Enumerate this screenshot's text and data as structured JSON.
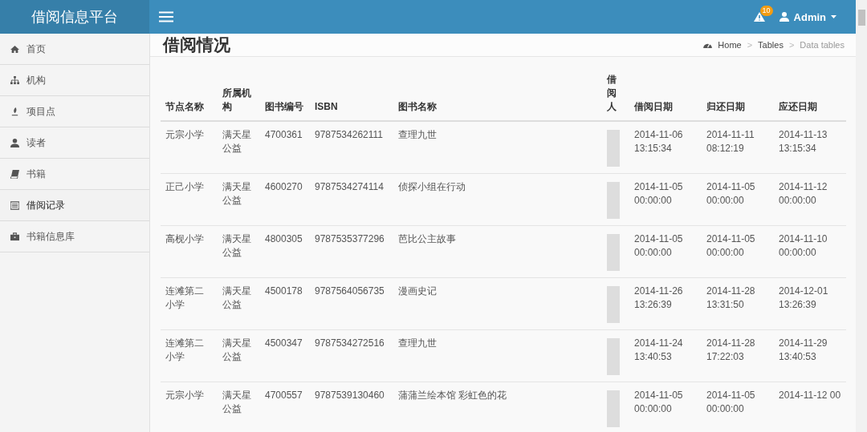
{
  "app": {
    "title": "借阅信息平台"
  },
  "navbar": {
    "alerts_badge": "10",
    "user": "Admin"
  },
  "sidebar": {
    "items": [
      {
        "label": "首页",
        "kind": "home",
        "selected": false
      },
      {
        "label": "机构",
        "kind": "sitemap",
        "selected": false
      },
      {
        "label": "项目点",
        "kind": "pin",
        "selected": false
      },
      {
        "label": "读者",
        "kind": "user",
        "selected": false
      },
      {
        "label": "书籍",
        "kind": "book",
        "selected": false
      },
      {
        "label": "借阅记录",
        "kind": "list",
        "selected": true
      },
      {
        "label": "书籍信息库",
        "kind": "briefcase",
        "selected": false
      }
    ]
  },
  "page": {
    "title": "借阅情况",
    "breadcrumb": [
      {
        "kind": "home",
        "label": "Home"
      },
      {
        "kind": "separator",
        "label": ">"
      },
      {
        "kind": "link",
        "label": "Tables"
      },
      {
        "kind": "separator",
        "label": ">"
      },
      {
        "kind": "current",
        "label": "Data tables"
      }
    ]
  },
  "table": {
    "columns": [
      "节点名称",
      "所属机构",
      "图书编号",
      "ISBN",
      "图书名称",
      "借阅人",
      "借阅日期",
      "归还日期",
      "应还日期"
    ],
    "rows": [
      {
        "node": "元宗小学",
        "org": "满天星公益",
        "book_no": "4700361",
        "isbn": "9787534262111",
        "title": "查理九世",
        "borrow_date": "2014-11-06 13:15:34",
        "return_date": "2014-11-11 08:12:19",
        "due_date": "2014-11-13 13:15:34"
      },
      {
        "node": "正己小学",
        "org": "满天星公益",
        "book_no": "4600270",
        "isbn": "9787534274114",
        "title": "侦探小组在行动",
        "borrow_date": "2014-11-05 00:00:00",
        "return_date": "2014-11-05 00:00:00",
        "due_date": "2014-11-12 00:00:00"
      },
      {
        "node": "高枧小学",
        "org": "满天星公益",
        "book_no": "4800305",
        "isbn": "9787535377296",
        "title": "芭比公主故事",
        "borrow_date": "2014-11-05 00:00:00",
        "return_date": "2014-11-05 00:00:00",
        "due_date": "2014-11-10 00:00:00"
      },
      {
        "node": "连滩第二小学",
        "org": "满天星公益",
        "book_no": "4500178",
        "isbn": "9787564056735",
        "title": "漫画史记",
        "borrow_date": "2014-11-26 13:26:39",
        "return_date": "2014-11-28 13:31:50",
        "due_date": "2014-12-01 13:26:39"
      },
      {
        "node": "连滩第二小学",
        "org": "满天星公益",
        "book_no": "4500347",
        "isbn": "9787534272516",
        "title": "查理九世",
        "borrow_date": "2014-11-24 13:40:53",
        "return_date": "2014-11-28 17:22:03",
        "due_date": "2014-11-29 13:40:53"
      },
      {
        "node": "元宗小学",
        "org": "满天星公益",
        "book_no": "4700557",
        "isbn": "9787539130460",
        "title": "蒲蒲兰绘本馆 彩虹色的花",
        "borrow_date": "2014-11-05 00:00:00",
        "return_date": "2014-11-05 00:00:00",
        "due_date": "2014-11-12 00"
      }
    ]
  }
}
